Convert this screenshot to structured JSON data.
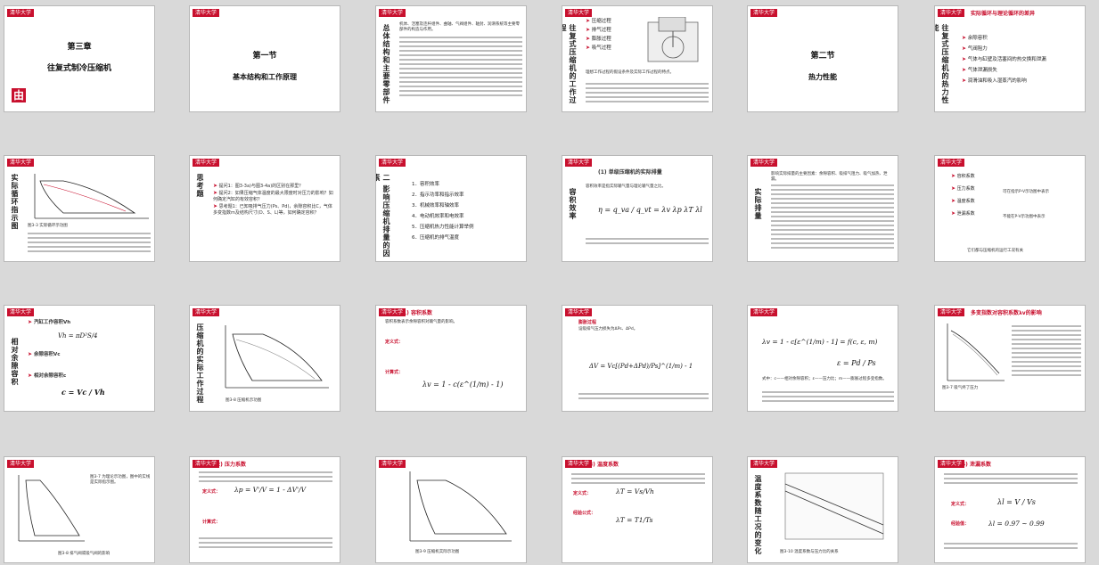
{
  "logo_text": "清华大学",
  "slides": [
    {
      "title_main": "第三章",
      "title_sub": "往复式制冷压缩机",
      "corner": "由"
    },
    {
      "title_main": "第一节",
      "title_sub": "基本结构和工作原理"
    },
    {
      "vtitle": "总体结构和主要零部件",
      "text": "机体、活塞及连杆组件、曲轴、气阀组件、轴封、润滑系统等主要零部件的构造与作用。"
    },
    {
      "vtitle": "往复式压缩机的工作过程",
      "items": [
        "压缩过程",
        "排气过程",
        "膨胀过程",
        "吸气过程"
      ],
      "text": "理想工作过程的假设条件及实际工作过程的特点。"
    },
    {
      "title_main": "第二节",
      "title_sub": "热力性能"
    },
    {
      "vtitle": "往复式压缩机的热力性能",
      "head": "实际循环与理论循环的差异",
      "items": [
        "余隙容积",
        "气阀阻力",
        "气体与缸壁及活塞间的热交换和泄漏",
        "气体泄漏损失",
        "润滑油和吸入湿蒸汽的影响"
      ]
    },
    {
      "vtitle": "实际循环指示图",
      "caption": "图3-3 实际循环示功图"
    },
    {
      "vtitle": "思考题",
      "items": [
        "提问1：图3-3a)与图3-4a)的区别在那里？",
        "提问2：如果压缩气体温度的最大限度时对压力的影响？如何确定汽缸的有效容积？",
        "思考题1：已知吸排气压力(Ps、Pd)，余隙容积比C，气体多变指数m及结构尺寸(D、S、L)等，如何确定容积？"
      ]
    },
    {
      "vtitle": "二 影响压缩机排量的因素",
      "items": [
        "1．容积效率",
        "2．指示功率和指示效率",
        "3．机械效率和轴效率",
        "4．电动机效率和电效率",
        "5．压缩机热力性能计算举例",
        "6．压缩机的排气温度"
      ]
    },
    {
      "head": "(1) 单级压缩机的实际排量",
      "vtitle": "容积效率",
      "formula": "η = q_va / q_vt = λv λp λT λl",
      "text": "容积效率是指实际输气量与理论输气量之比。"
    },
    {
      "vtitle": "实际排量",
      "text": "影响实际排量的主要因素：余隙容积、吸排气阻力、吸气加热、泄漏。"
    },
    {
      "items": [
        "容积系数",
        "压力系数",
        "温度系数",
        "泄漏系数"
      ],
      "note1": "可在指示P-V示功图中表示",
      "note2": "不能在P-V示功图中表示",
      "footer": "它们都与压缩机的运行工况有关"
    },
    {
      "vtitle": "相对余隙容积",
      "items": [
        "汽缸工作容积Vh",
        "余隙容积Vc",
        "相对余隙容积c"
      ],
      "formula1": "Vh = πD²S/4",
      "formula2": "c = Vc / Vh"
    },
    {
      "vtitle": "压缩机的实际工作过程",
      "caption": "图3-8 压缩机示功图"
    },
    {
      "head": "1) 容积系数",
      "formula1": "λv = 1 - c(ε^(1/m) - 1)",
      "text": "容积系数表示余隙容积对输气量的影响。",
      "label1": "定义式：",
      "label2": "计算式："
    },
    {
      "head": "膨胀过程",
      "formula": "ΔV = Vc[(Pd+ΔPd)/Ps]^(1/m) - 1",
      "text": "设吸排气压力损失为ΔPs、ΔPd。"
    },
    {
      "formula1": "λv = 1 - c[ε^(1/m) - 1] = f(c, ε, m)",
      "formula2": "ε = Pd / Ps",
      "text": "式中：c——相对余隙容积；ε——压力比；m——膨胀过程多变指数。"
    },
    {
      "head": "多变指数对容积系数λv的影响",
      "caption": "图3-7 吸气终了压力"
    },
    {
      "text": "图3-7 为理论示功图，图中的实线是实际指示图。",
      "caption": "图3-8 排气阀或吸气阀的影响"
    },
    {
      "head": "2) 压力系数",
      "formula1": "λp = V'/V = 1 - ΔV'/V",
      "label1": "定义式：",
      "label2": "计算式："
    },
    {
      "caption": "图3-9 压缩机实际示功图"
    },
    {
      "head": "3) 温度系数",
      "formula1": "λT = Vs/Vh",
      "formula2": "λT = T1/Ts",
      "label1": "定义式：",
      "label2": "经验公式："
    },
    {
      "vtitle": "温度系数随工况的变化",
      "caption": "图3-10 温度系数与压力比的关系"
    },
    {
      "head": "4) 泄漏系数",
      "formula1": "λl = V / Vs",
      "range": "λl = 0.97 ~ 0.99",
      "label1": "定义式：",
      "label2": "经验值："
    }
  ]
}
